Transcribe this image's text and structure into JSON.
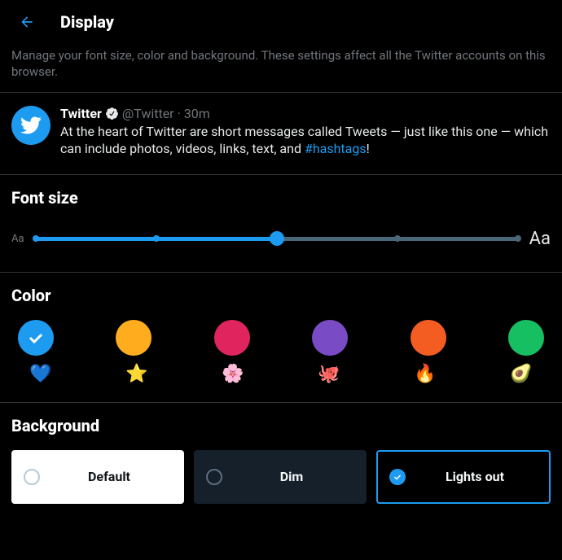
{
  "header": {
    "title": "Display"
  },
  "description": "Manage your font size, color and background. These settings affect all the Twitter accounts on this browser.",
  "tweet": {
    "name": "Twitter",
    "handle": "@Twitter",
    "time": "30m",
    "text_prefix": "At the heart of Twitter are short messages called Tweets — just like this one — which can include photos, videos, links, text, and ",
    "hashtag": "#hashtags",
    "text_suffix": "!"
  },
  "sections": {
    "font_size": "Font size",
    "color": "Color",
    "background": "Background"
  },
  "font_slider": {
    "small_label": "Aa",
    "large_label": "Aa",
    "steps": 5,
    "selected_index": 2
  },
  "colors": [
    {
      "hex": "#1d9bf0",
      "selected": true,
      "emoji": "💙",
      "name": "blue"
    },
    {
      "hex": "#ffad1f",
      "selected": false,
      "emoji": "⭐",
      "name": "yellow"
    },
    {
      "hex": "#e0245e",
      "selected": false,
      "emoji": "🌸",
      "name": "pink"
    },
    {
      "hex": "#794bc4",
      "selected": false,
      "emoji": "🐙",
      "name": "purple"
    },
    {
      "hex": "#f45d22",
      "selected": false,
      "emoji": "🔥",
      "name": "orange"
    },
    {
      "hex": "#17bf63",
      "selected": false,
      "emoji": "🥑",
      "name": "green"
    }
  ],
  "backgrounds": {
    "default": {
      "label": "Default",
      "selected": false
    },
    "dim": {
      "label": "Dim",
      "selected": false
    },
    "lights": {
      "label": "Lights out",
      "selected": true
    }
  }
}
